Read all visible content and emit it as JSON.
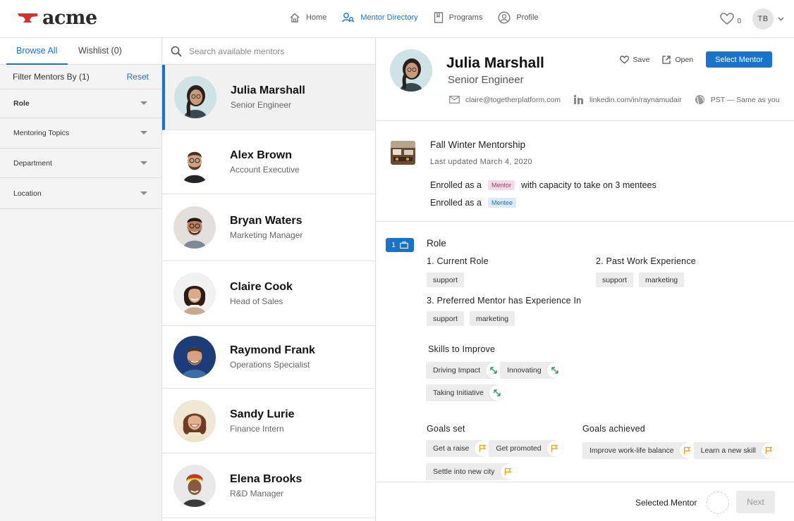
{
  "brand": {
    "name": "acme"
  },
  "nav": {
    "items": [
      {
        "label": "Home",
        "icon": "home-icon"
      },
      {
        "label": "Mentor Directory",
        "icon": "mentor-search-icon"
      },
      {
        "label": "Programs",
        "icon": "bookmark-icon"
      },
      {
        "label": "Profile",
        "icon": "user-icon"
      }
    ],
    "active": "Mentor Directory",
    "wishlist_count": "0",
    "user_initials": "TB"
  },
  "filters": {
    "tabs": [
      "Browse All",
      "Wishlist (0)"
    ],
    "active_tab": "Browse All",
    "title": "Filter Mentors By (1)",
    "reset_label": "Reset",
    "rows": [
      "Role",
      "Mentoring Topics",
      "Department",
      "Location"
    ]
  },
  "search": {
    "placeholder": "Search available mentors"
  },
  "mentors": [
    {
      "name": "Julia Marshall",
      "title": "Senior Engineer",
      "selected": true
    },
    {
      "name": "Alex Brown",
      "title": "Account Executive"
    },
    {
      "name": "Bryan Waters",
      "title": "Marketing Manager"
    },
    {
      "name": "Claire Cook",
      "title": "Head of Sales"
    },
    {
      "name": "Raymond Frank",
      "title": "Operations Specialist"
    },
    {
      "name": "Sandy Lurie",
      "title": "Finance Intern"
    },
    {
      "name": "Elena Brooks",
      "title": "R&D Manager"
    }
  ],
  "profile": {
    "name": "Julia Marshall",
    "title": "Senior Engineer",
    "actions": {
      "save": "Save",
      "open": "Open",
      "select": "Select Mentor"
    },
    "email": "claire@togetherplatform.com",
    "linkedin": "linkedin.com/in/raynamudair",
    "timezone": "PST — Same as you"
  },
  "program": {
    "title": "Fall Winter Mentorship",
    "updated": "Last updated March 4, 2020",
    "enroll_prefix": "Enrolled as a",
    "mentor_tag": "Mentor",
    "mentor_suffix": "with capacity to take on 3 mentees",
    "mentee_tag": "Mentee"
  },
  "role_section": {
    "badge_count": "1",
    "title": "Role",
    "current_role_label": "1. Current Role",
    "current_role": [
      "support"
    ],
    "past_label": "2. Past Work Experience",
    "past": [
      "support",
      "marketing"
    ],
    "preferred_label": "3. Preferred Mentor has Experience In",
    "preferred": [
      "support",
      "marketing"
    ],
    "skills_label": "Skills to Improve",
    "skills": [
      "Driving Impact",
      "Innovating",
      "Taking Initiative"
    ],
    "goals_set_label": "Goals set",
    "goals_set": [
      "Get a raise",
      "Get promoted",
      "Settle into new city"
    ],
    "goals_achieved_label": "Goals achieved",
    "goals_achieved": [
      "Improve work-life balance",
      "Learn a new skill"
    ]
  },
  "footer": {
    "selected_label": "Selected Mentor",
    "next_label": "Next"
  },
  "colors": {
    "accent": "#1a73c9",
    "logo_red": "#d5312f",
    "skill_green": "#3aa35a",
    "goal_orange": "#f0a020"
  }
}
